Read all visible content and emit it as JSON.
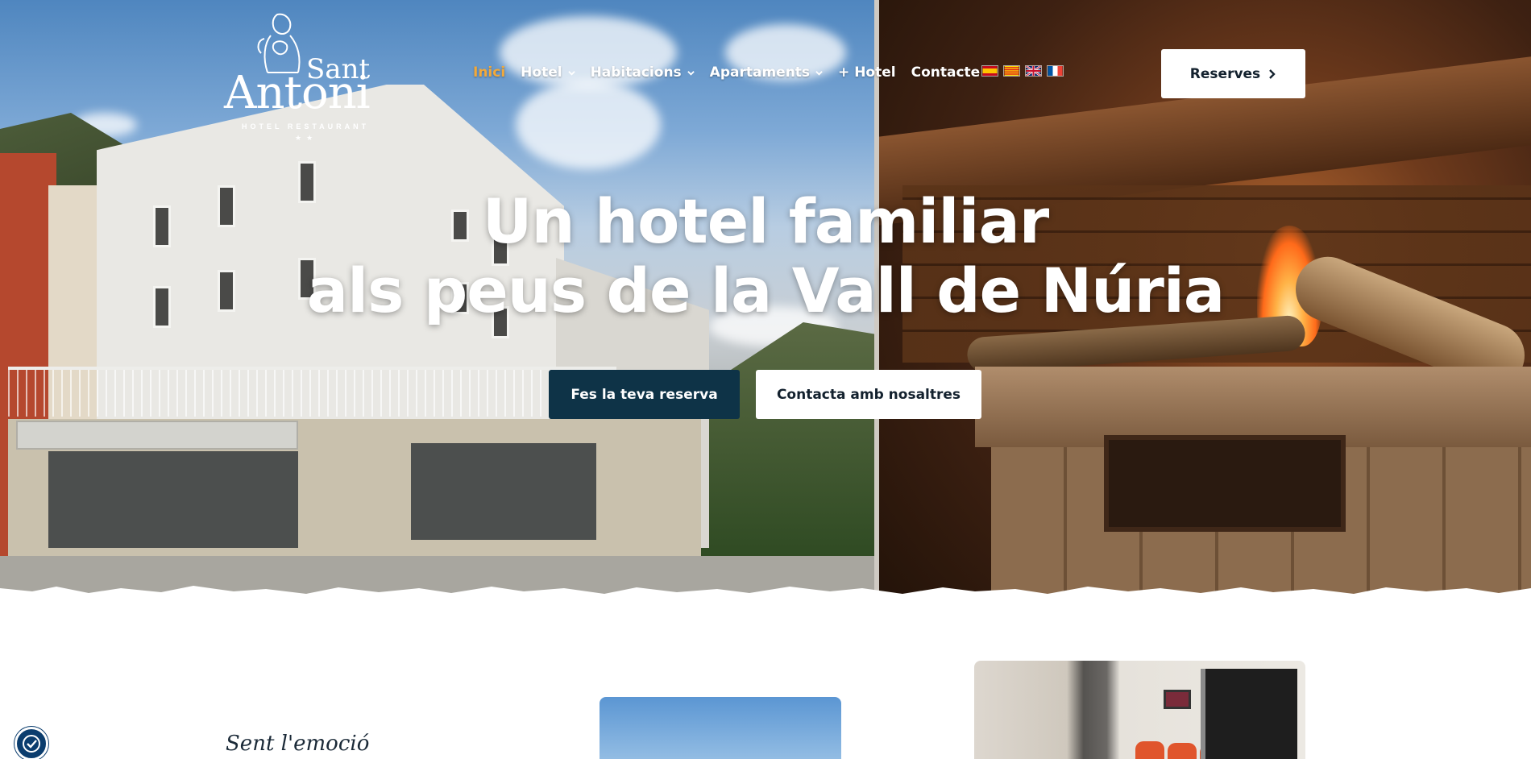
{
  "brand": {
    "name_line1": "Sant",
    "name_line2": "Antoni",
    "subtitle": "HOTEL RESTAURANT",
    "stars": "★★"
  },
  "nav": {
    "items": [
      {
        "label": "Inici",
        "active": true,
        "has_dropdown": false
      },
      {
        "label": "Hotel",
        "active": false,
        "has_dropdown": true
      },
      {
        "label": "Habitacions",
        "active": false,
        "has_dropdown": true
      },
      {
        "label": "Apartaments",
        "active": false,
        "has_dropdown": true
      },
      {
        "label": "+ Hotel",
        "active": false,
        "has_dropdown": false
      },
      {
        "label": "Contacte",
        "active": false,
        "has_dropdown": false
      }
    ],
    "languages": [
      "es",
      "ca",
      "en",
      "fr"
    ],
    "reserve_button": "Reserves"
  },
  "hero": {
    "title_line1": "Un hotel familiar",
    "title_line2": "als peus de la Vall de Núria",
    "cta_primary": "Fes la teva reserva",
    "cta_secondary": "Contacta amb nosaltres"
  },
  "intro": {
    "tagline": "Sent l'emoció"
  },
  "colors": {
    "accent": "#f2a93b",
    "primary_button": "#0e3347",
    "text_dark": "#13212e"
  },
  "icons": {
    "dropdown": "chevron-down-icon",
    "reserve": "chevron-right-icon",
    "accessibility": "accessibility-icon"
  }
}
